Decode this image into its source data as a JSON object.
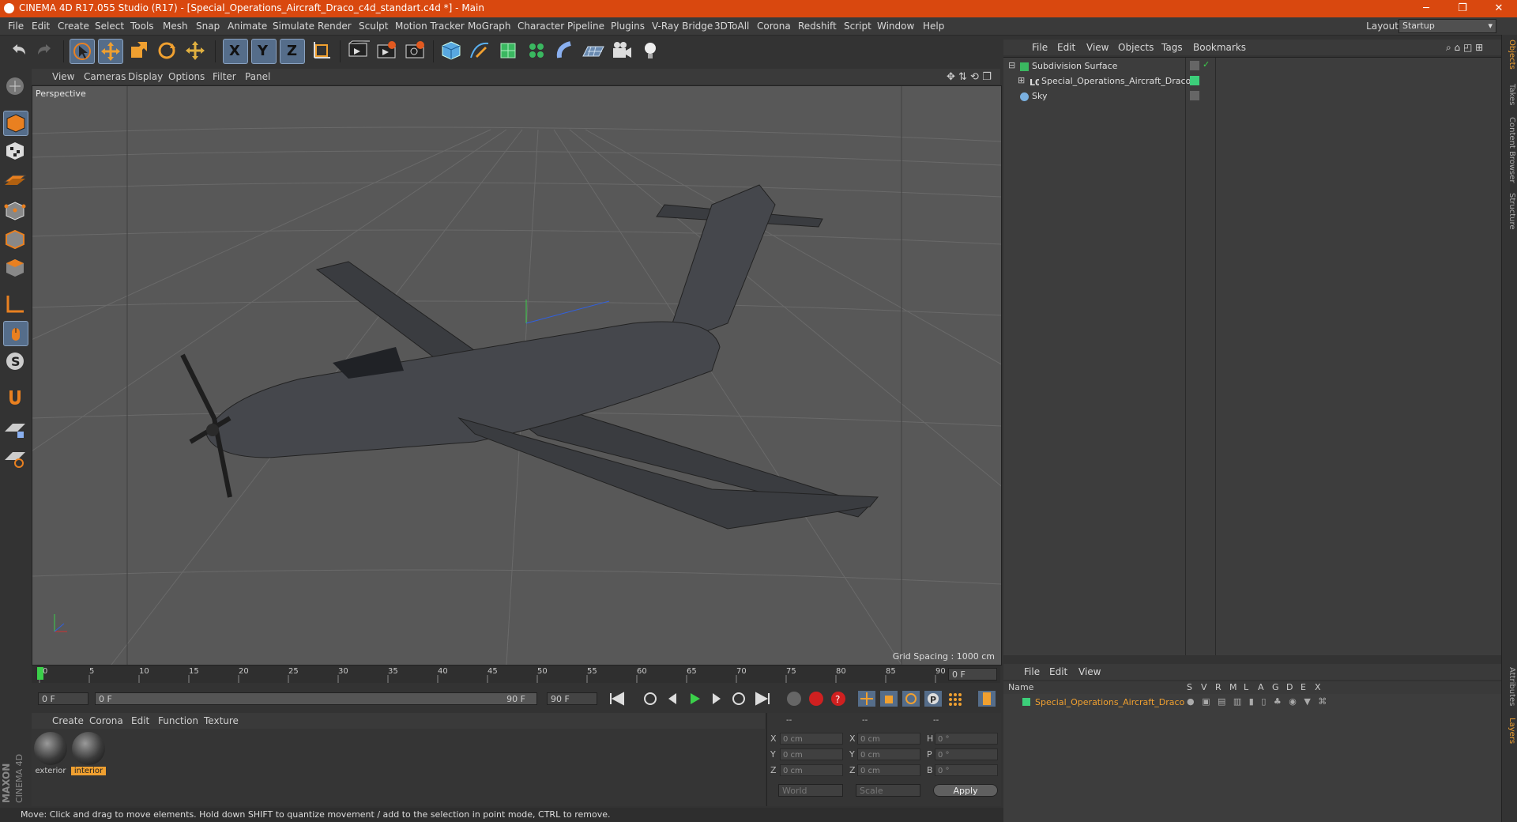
{
  "window": {
    "title": "CINEMA 4D R17.055 Studio (R17) - [Special_Operations_Aircraft_Draco_c4d_standart.c4d *] - Main",
    "minimize": "─",
    "restore": "❐",
    "close": "✕"
  },
  "menubar": {
    "items": [
      "File",
      "Edit",
      "Create",
      "Select",
      "Tools",
      "Mesh",
      "Snap",
      "Animate",
      "Simulate",
      "Render",
      "Sculpt",
      "Motion Tracker",
      "MoGraph",
      "Character",
      "Pipeline",
      "Plugins",
      "V-Ray Bridge",
      "3DToAll",
      "Corona",
      "Redshift",
      "Script",
      "Window",
      "Help"
    ],
    "layout_label": "Layout:",
    "layout_value": "Startup"
  },
  "toolbar": {
    "axis_x": "X",
    "axis_y": "Y",
    "axis_z": "Z"
  },
  "viewport": {
    "menu": [
      "View",
      "Cameras",
      "Display",
      "Options",
      "Filter",
      "Panel"
    ],
    "label": "Perspective",
    "grid_spacing": "Grid Spacing : 1000 cm"
  },
  "timeline": {
    "ticks": [
      "0",
      "5",
      "10",
      "15",
      "20",
      "25",
      "30",
      "35",
      "40",
      "45",
      "50",
      "55",
      "60",
      "65",
      "70",
      "75",
      "80",
      "85",
      "90"
    ],
    "current_frame": "0 F",
    "start_field": "0 F",
    "range_start": "0 F",
    "range_end": "90 F",
    "end_field": "90 F"
  },
  "material_manager": {
    "menu": [
      "Create",
      "Corona",
      "Edit",
      "Function",
      "Texture"
    ],
    "materials": [
      {
        "name": "exterior"
      },
      {
        "name": "interior"
      }
    ]
  },
  "coordinates": {
    "headers": [
      "--",
      "--",
      "--"
    ],
    "rows": [
      {
        "a": "X",
        "v1": "0 cm",
        "b": "X",
        "v2": "0 cm",
        "c": "H",
        "v3": "0 °"
      },
      {
        "a": "Y",
        "v1": "0 cm",
        "b": "Y",
        "v2": "0 cm",
        "c": "P",
        "v3": "0 °"
      },
      {
        "a": "Z",
        "v1": "0 cm",
        "b": "Z",
        "v2": "0 cm",
        "c": "B",
        "v3": "0 °"
      }
    ],
    "mode1": "World",
    "mode2": "Scale",
    "apply": "Apply"
  },
  "status": "Move: Click and drag to move elements. Hold down SHIFT to quantize movement / add to the selection in point mode, CTRL to remove.",
  "object_manager": {
    "menu": [
      "File",
      "Edit",
      "View",
      "Objects",
      "Tags",
      "Bookmarks"
    ],
    "objects": [
      {
        "name": "Subdivision Surface"
      },
      {
        "name": "Special_Operations_Aircraft_Draco"
      },
      {
        "name": "Sky"
      }
    ]
  },
  "layer_manager": {
    "menu": [
      "File",
      "Edit",
      "View"
    ],
    "columns": [
      "Name",
      "S",
      "V",
      "R",
      "M",
      "L",
      "A",
      "G",
      "D",
      "E",
      "X"
    ],
    "layers": [
      {
        "name": "Special_Operations_Aircraft_Draco",
        "color": "#3ccf7a"
      }
    ]
  },
  "right_tabs": [
    "Objects",
    "Takes",
    "Content Browser",
    "Structure",
    "Attributes",
    "Layers"
  ],
  "brand": "MAXON CINEMA 4D",
  "colors": {
    "accent": "#d9480f",
    "selected": "#556d8a",
    "highlight": "#f0a030",
    "layer_green": "#3ccf7a"
  }
}
